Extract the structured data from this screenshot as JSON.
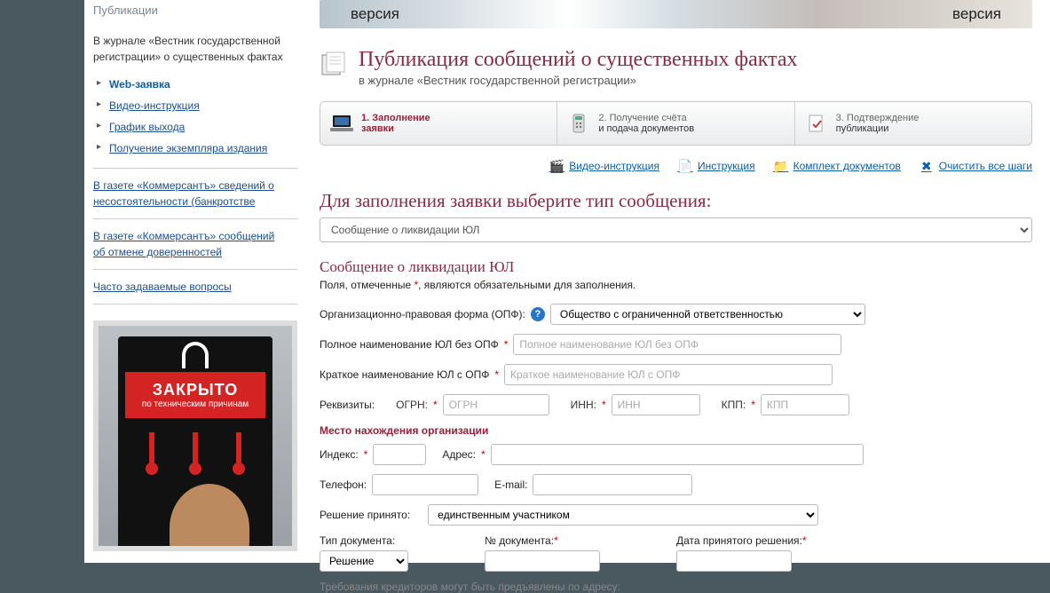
{
  "topBanner": {
    "left": "версия",
    "right": "версия"
  },
  "sidebar": {
    "heading": "Публикации",
    "block1": {
      "intro": "В журнале «Вестник государственной регистрации» о существенных фактах",
      "items": [
        {
          "label": "Web-заявка",
          "active": true
        },
        {
          "label": "Видео-инструкция",
          "active": false
        },
        {
          "label": "График выхода",
          "active": false
        },
        {
          "label": "Получение экземпляра издания",
          "active": false
        }
      ]
    },
    "block2": "В газете «Коммерсантъ» сведений о несостоятельности (банкротстве",
    "block3": "В газете «Коммерсантъ» сообщений\nоб отмене доверенностей",
    "block4": "Часто задаваемые вопросы",
    "banner": {
      "closed": "ЗАКРЫТО",
      "tech": "по техническим причинам"
    }
  },
  "page": {
    "title": "Публикация сообщений о существенных фактах",
    "subtitle": "в журнале «Вестник государственной регистрации»"
  },
  "steps": [
    {
      "n": "1.",
      "l1": "Заполнение",
      "l2": "заявки"
    },
    {
      "n": "2.",
      "l1": "Получение счёта",
      "l2": "и подача документов"
    },
    {
      "n": "3.",
      "l1": "Подтверждение",
      "l2": "публикации"
    }
  ],
  "tools": {
    "video": "Видео-инструкция",
    "instr": "Инструкция",
    "docs": "Комплект документов",
    "clear": "Очистить все шаги"
  },
  "form": {
    "chooseHeading": "Для заполнения заявки выберите тип сообщения:",
    "typeSelected": "Сообщение о ликвидации ЮЛ",
    "sectionTitle": "Сообщение о ликвидации ЮЛ",
    "noteA": "Поля, отмеченные ",
    "noteB": ", являются обязательными для заполнения.",
    "opf": {
      "label": "Организационно-правовая форма (ОПФ):",
      "selected": "Общество с ограниченной ответственностью"
    },
    "fullName": {
      "label": "Полное наименование ЮЛ без ОПФ",
      "placeholder": "Полное наименование ЮЛ без ОПФ"
    },
    "shortName": {
      "label": "Краткое наименование ЮЛ с ОПФ",
      "placeholder": "Краткое наименование ЮЛ с ОПФ"
    },
    "rekv": {
      "label": "Реквизиты:",
      "ogrnL": "ОГРН:",
      "ogrnP": "ОГРН",
      "innL": "ИНН:",
      "innP": "ИНН",
      "kppL": "КПП:",
      "kppP": "КПП"
    },
    "locHead": "Место нахождения организации",
    "indexL": "Индекс:",
    "addrL": "Адрес:",
    "phoneL": "Телефон:",
    "emailL": "E-mail:",
    "decision": {
      "label": "Решение принято:",
      "selected": "единственным участником"
    },
    "docType": {
      "label": "Тип документа:",
      "selected": "Решение"
    },
    "docNum": "№ документа:",
    "docDate": "Дата принятого решения:",
    "truncated": "Требования кредиторов могут быть предъявлены по адресу:"
  }
}
